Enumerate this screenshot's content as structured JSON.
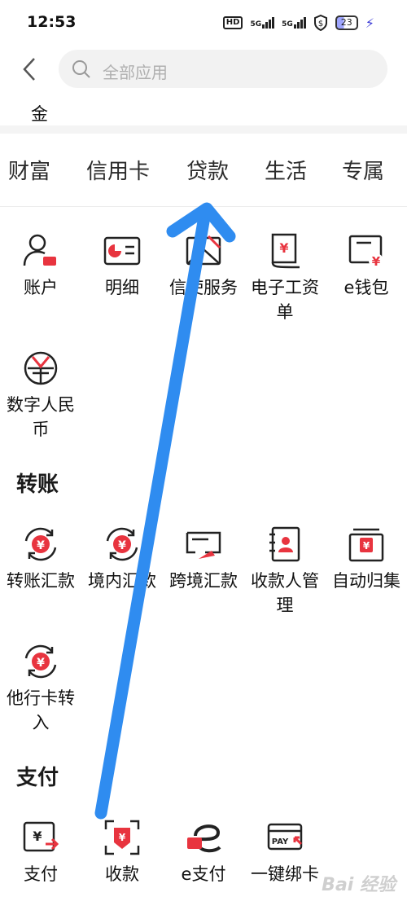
{
  "status": {
    "time": "12:53",
    "hd": "HD",
    "net1": "5G",
    "net2": "5G",
    "battery": "23"
  },
  "search": {
    "placeholder": "全部应用"
  },
  "hint": "金",
  "tabs": [
    "财富",
    "信用卡",
    "贷款",
    "生活",
    "专属"
  ],
  "account_section": {
    "items": [
      {
        "label": "账户",
        "icon": "account-icon"
      },
      {
        "label": "明细",
        "icon": "detail-icon"
      },
      {
        "label": "信使服务",
        "icon": "messenger-icon"
      },
      {
        "label": "电子工资单",
        "icon": "payslip-icon"
      },
      {
        "label": "e钱包",
        "icon": "wallet-icon"
      },
      {
        "label": "数字人民币",
        "icon": "digital-rmb-icon"
      }
    ]
  },
  "transfer_section": {
    "title": "转账",
    "items": [
      {
        "label": "转账汇款",
        "icon": "transfer-icon"
      },
      {
        "label": "境内汇款",
        "icon": "domestic-remit-icon"
      },
      {
        "label": "跨境汇款",
        "icon": "cross-border-icon"
      },
      {
        "label": "收款人管理",
        "icon": "payee-icon"
      },
      {
        "label": "自动归集",
        "icon": "auto-collect-icon"
      },
      {
        "label": "他行卡转入",
        "icon": "other-bank-icon"
      }
    ]
  },
  "payment_section": {
    "title": "支付",
    "items": [
      {
        "label": "支付",
        "icon": "pay-icon"
      },
      {
        "label": "收款",
        "icon": "receive-icon"
      },
      {
        "label": "e支付",
        "icon": "e-pay-icon"
      },
      {
        "label": "一键绑卡",
        "icon": "bind-card-icon"
      }
    ]
  },
  "watermark": "Bai 经验",
  "colors": {
    "accent": "#e8343f",
    "arrow": "#2f8cf0",
    "text": "#1a1a1a"
  }
}
